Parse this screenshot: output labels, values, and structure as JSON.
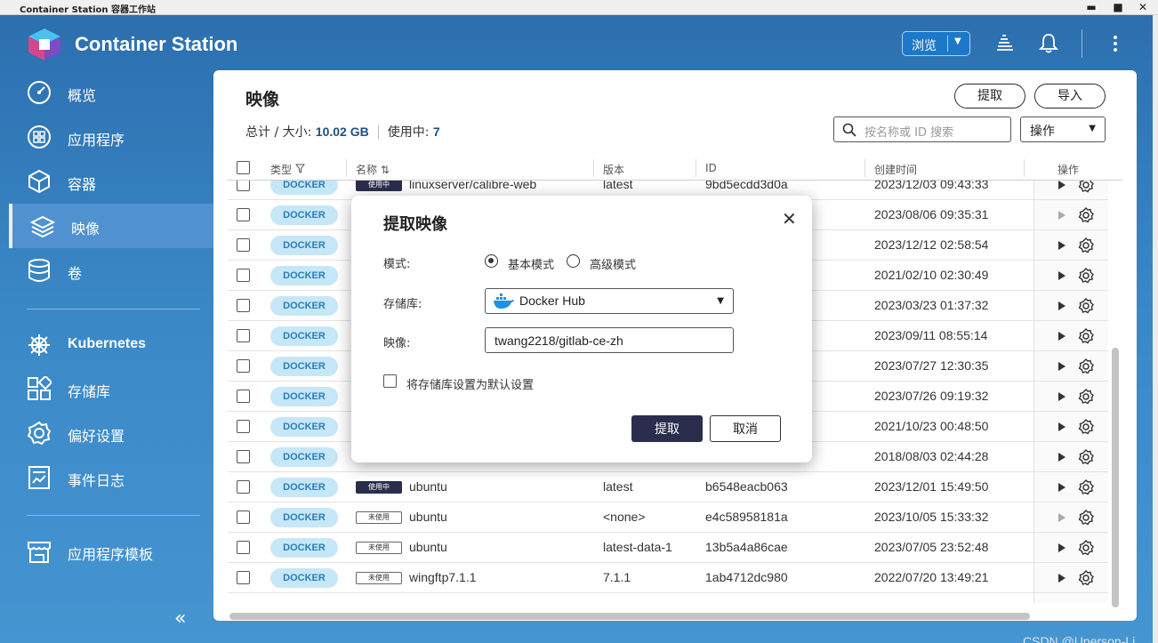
{
  "window": {
    "title": "Container Station 容器工作站",
    "minimize": "▬",
    "maximize": "■",
    "close": "✕"
  },
  "header": {
    "brand": "Container Station",
    "browse": "浏览"
  },
  "sidebar": {
    "items": [
      {
        "label": "概览",
        "icon": "dashboard-icon"
      },
      {
        "label": "应用程序",
        "icon": "apps-icon"
      },
      {
        "label": "容器",
        "icon": "container-icon"
      },
      {
        "label": "映像",
        "icon": "layers-icon",
        "active": true
      },
      {
        "label": "卷",
        "icon": "database-icon"
      },
      {
        "label": "Kubernetes",
        "icon": "helm-icon"
      },
      {
        "label": "存储库",
        "icon": "registry-icon"
      },
      {
        "label": "偏好设置",
        "icon": "gear-icon"
      },
      {
        "label": "事件日志",
        "icon": "log-icon"
      },
      {
        "label": "应用程序模板",
        "icon": "store-icon"
      }
    ],
    "collapse": "«"
  },
  "main": {
    "title": "映像",
    "summary": {
      "total_label": "总计 / 大小: ",
      "total_value": "10.02 GB",
      "in_use_label": "使用中: ",
      "in_use_value": "7"
    },
    "pull_button": "提取",
    "import_button": "导入",
    "search_placeholder": "按名称或 ID 搜索",
    "action_select": "操作",
    "columns": {
      "type": "类型",
      "name": "名称",
      "version": "版本",
      "id": "ID",
      "created": "创建时间",
      "action": "操作"
    },
    "docker_label": "DOCKER",
    "rows": [
      {
        "status": "使用中",
        "name": "linuxserver/calibre-web",
        "version": "latest",
        "id": "9bd5ecdd3d0a",
        "created": "2023/12/03 09:43:33",
        "play": true
      },
      {
        "status": "",
        "name": "",
        "version": "",
        "id": "",
        "created": "2023/08/06 09:35:31",
        "play": false
      },
      {
        "status": "",
        "name": "",
        "version": "",
        "id": "",
        "created": "2023/12/12 02:58:54",
        "play": true
      },
      {
        "status": "",
        "name": "",
        "version": "",
        "id": "",
        "created": "2021/02/10 02:30:49",
        "play": true
      },
      {
        "status": "",
        "name": "",
        "version": "",
        "id": "",
        "created": "2023/03/23 01:37:32",
        "play": true
      },
      {
        "status": "",
        "name": "",
        "version": "",
        "id": "",
        "created": "2023/09/11 08:55:14",
        "play": true
      },
      {
        "status": "",
        "name": "",
        "version": "",
        "id": "",
        "created": "2023/07/27 12:30:35",
        "play": true
      },
      {
        "status": "",
        "name": "",
        "version": "",
        "id": "",
        "created": "2023/07/26 09:19:32",
        "play": true
      },
      {
        "status": "",
        "name": "",
        "version": "",
        "id": "",
        "created": "2021/10/23 00:48:50",
        "play": true
      },
      {
        "status": "",
        "name": "",
        "version": "",
        "id": "",
        "created": "2018/08/03 02:44:28",
        "play": true
      },
      {
        "status": "使用中",
        "name": "ubuntu",
        "version": "latest",
        "id": "b6548eacb063",
        "created": "2023/12/01 15:49:50",
        "play": true
      },
      {
        "status": "未使用",
        "name": "ubuntu",
        "version": "<none>",
        "id": "e4c58958181a",
        "created": "2023/10/05 15:33:32",
        "play": false
      },
      {
        "status": "未使用",
        "name": "ubuntu",
        "version": "latest-data-1",
        "id": "13b5a4a86cae",
        "created": "2023/07/05 23:52:48",
        "play": true
      },
      {
        "status": "未使用",
        "name": "wingftp7.1.1",
        "version": "7.1.1",
        "id": "1ab4712dc980",
        "created": "2022/07/20 13:49:21",
        "play": true
      }
    ]
  },
  "dialog": {
    "title": "提取映像",
    "close": "✕",
    "mode_label": "模式:",
    "mode_basic": "基本模式",
    "mode_advanced": "高级模式",
    "repo_label": "存储库:",
    "repo_value": "Docker Hub",
    "image_label": "映像:",
    "image_value": "twang2218/gitlab-ce-zh",
    "default_checkbox": "将存储库设置为默认设置",
    "pull_button": "提取",
    "cancel_button": "取消"
  },
  "watermark": "CSDN @Uperson-Li"
}
